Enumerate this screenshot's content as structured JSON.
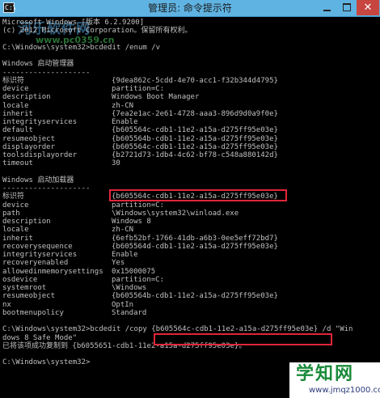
{
  "window": {
    "title": "管理员: 命令提示符",
    "icon_label": "C:\\",
    "close_glyph": "✕"
  },
  "watermarks": [
    "河乐软件网",
    "www.pc0359.cn"
  ],
  "lines": [
    "Microsoft Windows [版本 6.2.9200]",
    "(c) 2012 Microsoft Corporation。保留所有权利。",
    "",
    "C:\\Windows\\system32>bcdedit /enum /v",
    "",
    "Windows 启动管理器",
    "--------------------",
    "标识符",
    "device",
    "description",
    "locale",
    "inherit",
    "integrityservices",
    "default",
    "resumeobject",
    "displayorder",
    "toolsdisplayorder",
    "timeout",
    "",
    "Windows 启动加载器",
    "--------------------",
    "标识符",
    "device",
    "path",
    "description",
    "locale",
    "inherit",
    "recoverysequence",
    "integrityservices",
    "recoveryenabled",
    "allowedinmemorysettings",
    "osdevice",
    "systemroot",
    "resumeobject",
    "nx",
    "bootmenupolicy",
    "",
    "C:\\Windows\\system32>bcdedit /copy {b605564c-cdb1-11e2-a15a-d275ff95e03e} /d \"Win",
    "dows 8 Safe Mode\"",
    "已将该项成功复制到 {b6055651-cdb1-11e2-a15a-d275ff95e03e}。",
    "",
    "C:\\Windows\\system32>"
  ],
  "values": [
    {
      "row": 7,
      "text": "{9dea862c-5cdd-4e70-acc1-f32b344d4795}"
    },
    {
      "row": 8,
      "text": "partition=C:"
    },
    {
      "row": 9,
      "text": "Windows Boot Manager"
    },
    {
      "row": 10,
      "text": "zh-CN"
    },
    {
      "row": 11,
      "text": "{7ea2e1ac-2e61-4728-aaa3-896d9d0a9f0e}"
    },
    {
      "row": 12,
      "text": "Enable"
    },
    {
      "row": 13,
      "text": "{b605564c-cdb1-11e2-a15a-d275ff95e03e}"
    },
    {
      "row": 14,
      "text": "{b605564b-cdb1-11e2-a15a-d275ff95e03e}"
    },
    {
      "row": 15,
      "text": "{b605564c-cdb1-11e2-a15a-d275ff95e03e}"
    },
    {
      "row": 16,
      "text": "{b2721d73-1db4-4c62-bf78-c548a880142d}"
    },
    {
      "row": 17,
      "text": "30"
    },
    {
      "row": 21,
      "text": "{b605564c-cdb1-11e2-a15a-d275ff95e03e}"
    },
    {
      "row": 22,
      "text": "partition=C:"
    },
    {
      "row": 23,
      "text": "\\Windows\\system32\\winload.exe"
    },
    {
      "row": 24,
      "text": "Windows 8"
    },
    {
      "row": 25,
      "text": "zh-CN"
    },
    {
      "row": 26,
      "text": "{6efb52bf-1766-41db-a6b3-0ee5eff72bd7}"
    },
    {
      "row": 27,
      "text": "{b605564d-cdb1-11e2-a15a-d275ff95e03e}"
    },
    {
      "row": 28,
      "text": "Enable"
    },
    {
      "row": 29,
      "text": "Yes"
    },
    {
      "row": 30,
      "text": "0x15000075"
    },
    {
      "row": 31,
      "text": "partition=C:"
    },
    {
      "row": 32,
      "text": "\\Windows"
    },
    {
      "row": 33,
      "text": "{b605564b-cdb1-11e2-a15a-d275ff95e03e}"
    },
    {
      "row": 34,
      "text": "OptIn"
    },
    {
      "row": 35,
      "text": "Standard"
    }
  ],
  "highlights": [
    {
      "row": 21,
      "label": "loader-identifier"
    },
    {
      "row": 37,
      "label": "copy-command-guid"
    }
  ],
  "logo": {
    "title": "学知网",
    "url": "www.jmqz1000.com"
  },
  "colors": {
    "console_text": "#c0c0c0",
    "console_bg": "#000000",
    "titlebar": "#5fb3e2",
    "highlight_border": "#e0263a",
    "close_button": "#c7463f"
  }
}
